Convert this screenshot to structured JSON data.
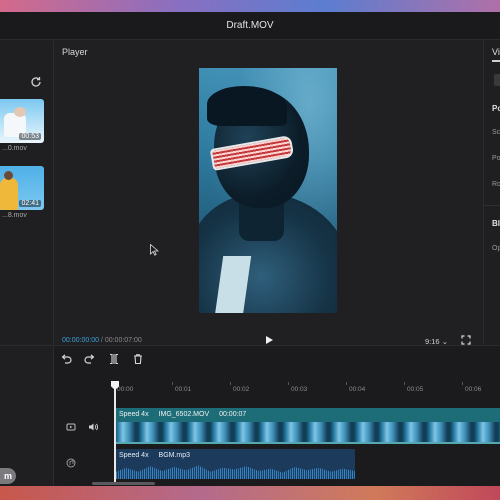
{
  "window": {
    "title": "Draft.MOV"
  },
  "media": {
    "items": [
      {
        "duration": "00:53",
        "filename": "...0.mov"
      },
      {
        "duration": "02:41",
        "filename": "...8.mov"
      }
    ]
  },
  "player": {
    "label": "Player",
    "current_time": "00:00:00:00",
    "separator": " / ",
    "total_time": "00:00:07:00",
    "aspect_ratio": "9:16",
    "aspect_caret": "⌄"
  },
  "inspector": {
    "tab_label": "Vi",
    "labels": [
      "Po",
      "Sc",
      "Po",
      "Ro",
      "Bl",
      "Op"
    ]
  },
  "timeline": {
    "ruler_ticks": [
      "00:00",
      "00:01",
      "00:02",
      "00:03",
      "00:04",
      "00:05",
      "00:06"
    ],
    "video_clip": {
      "speed": "Speed 4x",
      "name": "IMG_6502.MOV",
      "duration": "00:00:07"
    },
    "audio_clip": {
      "speed": "Speed 4x",
      "name": "BGM.mp3"
    }
  },
  "colors": {
    "accent_timecode": "#3b9fd8",
    "video_track": "#1d6d78",
    "audio_track": "#1b3a5c"
  },
  "icons": [
    "refresh-icon",
    "cursor-icon",
    "play-icon",
    "fullscreen-icon",
    "undo-icon",
    "redo-icon",
    "split-icon",
    "delete-icon",
    "video-track-icon",
    "volume-icon",
    "audio-track-icon"
  ],
  "logo": {
    "text": "m"
  }
}
